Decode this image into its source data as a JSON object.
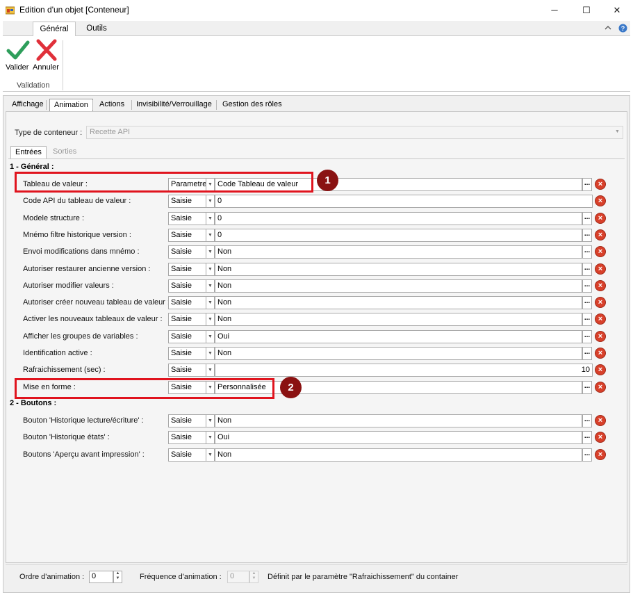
{
  "window": {
    "title": "Edition d'un objet [Conteneur]",
    "minimize_glyph": "─",
    "maximize_glyph": "☐",
    "close_glyph": "✕"
  },
  "ribbon": {
    "tabs": [
      "Général",
      "Outils"
    ],
    "active_tab": "Général",
    "buttons": {
      "validate_label": "Valider",
      "cancel_label": "Annuler"
    },
    "group_label": "Validation",
    "right_icons": [
      "chevron-up-icon",
      "help-icon"
    ]
  },
  "panel_tabs": [
    "Affichage",
    "Animation",
    "Actions",
    "Invisibilité/Verrouillage",
    "Gestion des rôles"
  ],
  "active_panel_tab": "Animation",
  "container_type": {
    "label": "Type de conteneur :",
    "value": "Recette API"
  },
  "sub_tabs": [
    "Entrées",
    "Sorties"
  ],
  "active_sub_tab": "Entrées",
  "sections": [
    {
      "title": "1 - Général :",
      "rows": [
        {
          "label": "Tableau de valeur :",
          "mode": "Parametre",
          "value": "Code Tableau de valeur"
        },
        {
          "label": "Code API du tableau de valeur :",
          "mode": "Saisie",
          "value": "0"
        },
        {
          "label": "Modele structure :",
          "mode": "Saisie",
          "value": "0"
        },
        {
          "label": "Mnémo filtre historique version :",
          "mode": "Saisie",
          "value": "0"
        },
        {
          "label": "Envoi modifications dans mnémo :",
          "mode": "Saisie",
          "value": "Non"
        },
        {
          "label": "Autoriser restaurer ancienne version :",
          "mode": "Saisie",
          "value": "Non"
        },
        {
          "label": "Autoriser modifier valeurs :",
          "mode": "Saisie",
          "value": "Non"
        },
        {
          "label": "Autoriser créer nouveau tableau de valeur :",
          "mode": "Saisie",
          "value": "Non"
        },
        {
          "label": "Activer les nouveaux tableaux de valeur :",
          "mode": "Saisie",
          "value": "Non"
        },
        {
          "label": "Afficher les groupes de variables :",
          "mode": "Saisie",
          "value": "Oui"
        },
        {
          "label": "Identification active :",
          "mode": "Saisie",
          "value": "Non"
        },
        {
          "label": "Rafraichissement (sec) :",
          "mode": "Saisie",
          "value": "10"
        },
        {
          "label": "Mise en forme :",
          "mode": "Saisie",
          "value": "Personnalisée"
        }
      ]
    },
    {
      "title": "2 - Boutons :",
      "rows": [
        {
          "label": "Bouton 'Historique lecture/écriture' :",
          "mode": "Saisie",
          "value": "Non"
        },
        {
          "label": "Bouton 'Historique états' :",
          "mode": "Saisie",
          "value": "Oui"
        },
        {
          "label": "Boutons 'Aperçu avant impression' :",
          "mode": "Saisie",
          "value": "Non"
        }
      ]
    }
  ],
  "badges": [
    "1",
    "2"
  ],
  "footer": {
    "ordre_label": "Ordre d'animation :",
    "ordre_value": "0",
    "frequence_label": "Fréquence d'animation :",
    "frequence_value": "0",
    "note": "Définit par le paramètre \"Rafraichissement\" du container"
  },
  "colors": {
    "highlight": "#e0141e",
    "badge": "#8a1212",
    "validate": "#2e9e5b",
    "cancel": "#e0303a"
  }
}
